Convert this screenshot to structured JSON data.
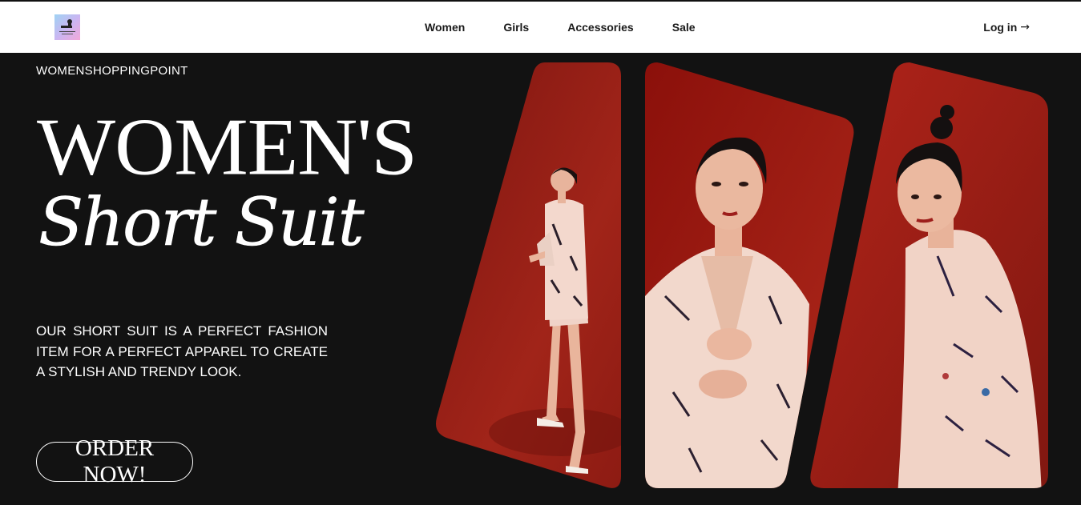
{
  "nav": {
    "logo_alt": "womenshoppingpoint logo",
    "links": [
      "Women",
      "Girls",
      "Accessories",
      "Sale"
    ],
    "login": "Log in",
    "login_arrow": "→"
  },
  "hero": {
    "brand": "WOMENSHOPPINGPOINT",
    "title": "WOMEN'S",
    "subtitle": "Short Suit",
    "description": "OUR SHORT SUIT IS A PERFECT FASHION ITEM FOR A PERFECT APPAREL TO CREATE A STYLISH AND TRENDY LOOK.",
    "cta": "ORDER NOW!"
  },
  "colors": {
    "background": "#121212",
    "navbar": "#ffffff",
    "photo_backdrop": "#8e1a12",
    "suit": "#f0d3c8"
  }
}
